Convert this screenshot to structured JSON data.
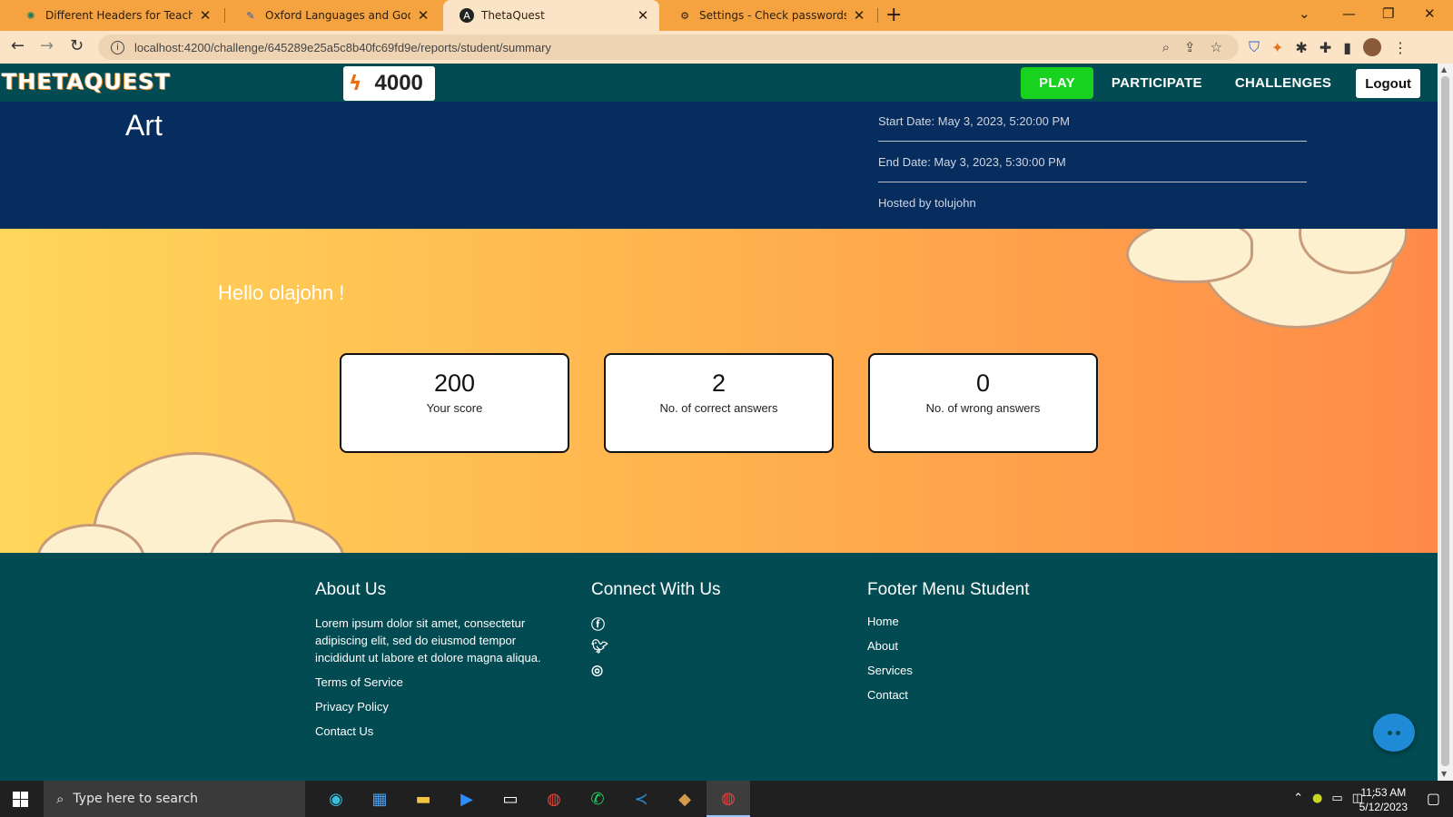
{
  "browser": {
    "tabs": [
      {
        "title": "Different Headers for Teachers ar",
        "icon": "openai-icon",
        "active": false
      },
      {
        "title": "Oxford Languages and Google -",
        "icon": "oxford-icon",
        "active": false
      },
      {
        "title": "ThetaQuest",
        "icon": "angular-icon",
        "active": true
      },
      {
        "title": "Settings - Check passwords",
        "icon": "gear-icon",
        "active": false
      }
    ],
    "new_tab": "+",
    "url": "localhost:4200/challenge/645289e25a5c8b40fc69fd9e/reports/student/summary"
  },
  "app": {
    "brand": "THETAQUEST",
    "coins": "4000",
    "nav": {
      "play": "PLAY",
      "participate": "PARTICIPATE",
      "challenges": "CHALLENGES",
      "logout": "Logout"
    }
  },
  "challenge": {
    "title": "Art",
    "start_date": "Start Date: May 3, 2023, 5:20:00 PM",
    "end_date": "End Date: May 3, 2023, 5:30:00 PM",
    "host": "Hosted by tolujohn"
  },
  "summary": {
    "greeting": "Hello olajohn !",
    "cards": [
      {
        "value": "200",
        "label": "Your score"
      },
      {
        "value": "2",
        "label": "No. of correct answers"
      },
      {
        "value": "0",
        "label": "No. of wrong answers"
      }
    ]
  },
  "footer": {
    "about": {
      "heading": "About Us",
      "text": "Lorem ipsum dolor sit amet, consectetur adipiscing elit, sed do eiusmod tempor incididunt ut labore et dolore magna aliqua.",
      "links": [
        "Terms of Service",
        "Privacy Policy",
        "Contact Us"
      ]
    },
    "connect": {
      "heading": "Connect With Us",
      "icons": [
        "facebook-icon",
        "twitter-icon",
        "instagram-icon"
      ]
    },
    "menu": {
      "heading": "Footer Menu Student",
      "links": [
        "Home",
        "About",
        "Services",
        "Contact"
      ]
    }
  },
  "taskbar": {
    "search_placeholder": "Type here to search",
    "time": "11:53 AM",
    "date": "5/12/2023"
  },
  "colors": {
    "nav_bg": "#024b52",
    "hero_bg": "#072c5e",
    "play_btn": "#19d11f",
    "band_start": "#ffd65a",
    "band_end": "#ff8a48"
  }
}
